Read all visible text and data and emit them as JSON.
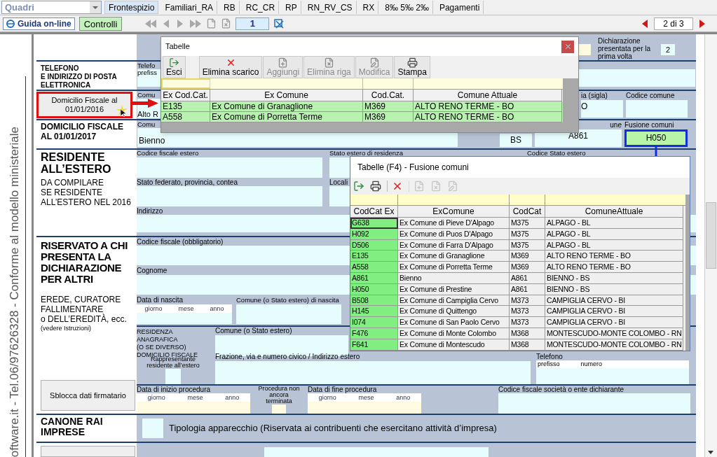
{
  "top_bar": {
    "combo": "Quadri",
    "tabs": [
      {
        "label": "Frontespizio",
        "selected": true
      },
      {
        "label": "Familiari_RA",
        "selected": false
      },
      {
        "label": "RB",
        "selected": false
      },
      {
        "label": "RC_CR",
        "selected": false
      },
      {
        "label": "RP",
        "selected": false
      },
      {
        "label": "RN_RV_CS",
        "selected": false
      },
      {
        "label": "RX",
        "selected": false
      },
      {
        "label": "8‰ 5‰ 2‰",
        "selected": false
      },
      {
        "label": "Pagamenti",
        "selected": false
      }
    ]
  },
  "toolbar": {
    "guide_button": "Guida on-line",
    "check_button": "Controlli",
    "page": "1",
    "page_indicator": "2 di 3"
  },
  "side_text": "oftware.it - Tel.06/97626328 - Conforme al modello ministeriale",
  "form": {
    "first_declaration": {
      "label": "Dichiarazione presentata per la prima volta",
      "value": "2"
    },
    "phone": {
      "heading": "TELEFONO\nE INDIRIZZO DI POSTA\nELETTRONICA",
      "label": "Telefo",
      "sublabel": "prefiss"
    },
    "domicile_2016": {
      "button": "Domicilio Fiscale al\n01/01/2016",
      "highlighted": true,
      "comune_label": "Comu",
      "comune_value": "Alto R",
      "province_label": "ia (sigla)",
      "province_value": "O",
      "code_label": "Codice comune"
    },
    "domicile_2017": {
      "heading": "DOMICILIO FISCALE\nAL 01/01/2017",
      "comune_label": "Comu",
      "comune_value": "Bienno",
      "province_value": "BS",
      "code_label": "une",
      "code_value": "A861",
      "fusion_label": "Fusione comuni",
      "fusion_value": "H050",
      "highlighted": true
    },
    "resident_abroad": {
      "heading": "RESIDENTE\nALL’ESTERO",
      "note": "DA COMPILARE\nSE RESIDENTE\nALL’ESTERO NEL 2016",
      "tax_code_label": "Codice fiscale estero",
      "country_label": "Stato estero di residenza",
      "country_code_label": "Codice Stato estero",
      "state_label": "Stato federato, provincia, contea",
      "city_label": "Locali",
      "address_label": "Indirizzo"
    },
    "reserved": {
      "heading": "RISERVATO A CHI\nPRESENTA LA\nDICHIARAZIONE\nPER ALTRI",
      "note": "EREDE, CURATORE\nFALLIMENTARE\no DELL’EREDITÀ, ecc.",
      "hint": "(vedere Istruzioni)",
      "unlock_button": "Sblocca dati firmatario",
      "tax_code_label": "Codice fiscale (obbligatorio)",
      "surname_label": "Cognome",
      "birth_date_label": "Data di nascita",
      "birth_date_parts": [
        "giorno",
        "mese",
        "anno"
      ],
      "birth_place_label": "Comune (o Stato estero) di nascita",
      "residence_label": "RESIDENZA ANAGRAFICA\n(O SE DIVERSO)\nDOMICILIO FISCALE",
      "residence_city_label": "Comune (o Stato estero)",
      "representative_label": "Rappresentante\nresidente all’estero",
      "address_label": "Frazione, via e numero civico / Indirizzo estero",
      "phone_label": "Telefono",
      "phone_parts": [
        "prefisso",
        "numero"
      ],
      "start_label": "Data di inizio procedura",
      "start_date_parts": [
        "giorno",
        "mese",
        "anno"
      ],
      "not_finished_label": "Procedura non\nancora terminata",
      "end_label": "Data di fine procedura",
      "end_date_parts": [
        "giorno",
        "mese",
        "anno"
      ],
      "company_label": "Codice fiscale società o ente dichiarante"
    },
    "rai": {
      "heading": "CANONE RAI\nIMPRESE",
      "label": "Tipologia apparecchio (Riservata ai contribuenti che esercitano attività d’impresa)"
    }
  },
  "table_window": {
    "title": "Tabelle",
    "buttons": [
      {
        "label": "Esci",
        "kind": "exit",
        "disabled": false
      },
      {
        "label": "Elimina scarico",
        "kind": "delete",
        "disabled": false
      },
      {
        "label": "Aggiungi",
        "kind": "add",
        "disabled": true
      },
      {
        "label": "Elimina riga",
        "kind": "remove",
        "disabled": true
      },
      {
        "label": "Modifica",
        "kind": "edit",
        "disabled": true
      },
      {
        "label": "Stampa",
        "kind": "print",
        "disabled": false
      }
    ],
    "columns": [
      "Ex Cod.Cat.",
      "Ex Comune",
      "Cod.Cat.",
      "Comune Attuale"
    ],
    "rows": [
      [
        "E135",
        "Ex Comune di Granaglione",
        "M369",
        "ALTO RENO TERME - BO"
      ],
      [
        "A558",
        "Ex Comune di Porretta Terme",
        "M369",
        "ALTO RENO TERME - BO"
      ]
    ]
  },
  "fusion_window": {
    "title": "Tabelle (F4) - Fusione comuni",
    "tools": [
      {
        "kind": "exit",
        "disabled": false
      },
      {
        "kind": "print",
        "disabled": false
      },
      {
        "kind": "delete",
        "disabled": false
      },
      {
        "kind": "add",
        "disabled": true
      },
      {
        "kind": "remove",
        "disabled": true
      },
      {
        "kind": "edit",
        "disabled": true
      }
    ],
    "columns": [
      "CodCat Ex",
      "ExComune",
      "CodCat",
      "ComuneAttuale"
    ],
    "rows": [
      {
        "cells": [
          "G638",
          "Ex Comune di Pieve D'Alpago",
          "M375",
          "ALPAGO - BL"
        ],
        "selected": true
      },
      {
        "cells": [
          "H092",
          "Ex Comune di Puos D'Alpago",
          "M375",
          "ALPAGO - BL"
        ],
        "selected": false
      },
      {
        "cells": [
          "D506",
          "Ex Comune di Farra D'Alpago",
          "M375",
          "ALPAGO - BL"
        ],
        "selected": false
      },
      {
        "cells": [
          "E135",
          "Ex Comune di Granaglione",
          "M369",
          "ALTO RENO TERME - BO"
        ],
        "selected": false
      },
      {
        "cells": [
          "A558",
          "Ex Comune di Porretta Terme",
          "M369",
          "ALTO RENO TERME - BO"
        ],
        "selected": false
      },
      {
        "cells": [
          "A861",
          "Bienno",
          "A861",
          "BIENNO - BS"
        ],
        "selected": false
      },
      {
        "cells": [
          "H050",
          "Ex Comune di Prestine",
          "A861",
          "BIENNO - BS"
        ],
        "selected": false
      },
      {
        "cells": [
          "B508",
          "Ex Comune di Campiglia Cervo",
          "M373",
          "CAMPIGLIA CERVO - BI"
        ],
        "selected": false
      },
      {
        "cells": [
          "H145",
          "Ex Comune di Quittengo",
          "M373",
          "CAMPIGLIA CERVO - BI"
        ],
        "selected": false
      },
      {
        "cells": [
          "I074",
          "Ex Comune di San Paolo Cervo",
          "M373",
          "CAMPIGLIA CERVO - BI"
        ],
        "selected": false
      },
      {
        "cells": [
          "F476",
          "Ex Comune di Monte Colombo",
          "M368",
          "MONTESCUDO-MONTE COLOMBO - RN"
        ],
        "selected": false
      },
      {
        "cells": [
          "F641",
          "Ex Comune di Montescudo",
          "M368",
          "MONTESCUDO-MONTE COLOMBO - RN"
        ],
        "selected": false
      }
    ]
  }
}
